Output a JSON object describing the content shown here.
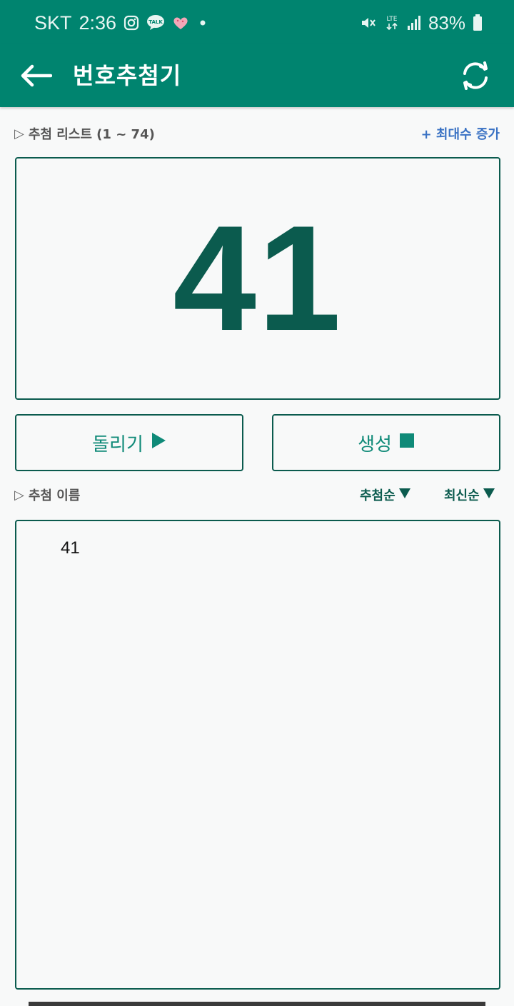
{
  "statusbar": {
    "carrier": "SKT",
    "time": "2:36",
    "notification_icons": [
      "instagram-icon",
      "kakaotalk-icon",
      "heart-icon",
      "dot-icon"
    ],
    "talk_badge": "TALK",
    "lte_label": "LTE",
    "battery": "83%"
  },
  "appbar": {
    "title": "번호추첨기"
  },
  "draw_list": {
    "label": "추첨 리스트 (1 ~ 74)",
    "increase_max_label": "+ 최대수 증가",
    "current_number": "41"
  },
  "actions": {
    "spin_label": "돌리기",
    "generate_label": "생성"
  },
  "names_section": {
    "label": "추첨 이름",
    "sort_draw_order": "추첨순",
    "sort_latest": "최신순",
    "items": [
      "41"
    ]
  },
  "colors": {
    "primary": "#00846f",
    "dark_green": "#0b5b4e",
    "button_text": "#0f8a78",
    "link_blue": "#3a72c4"
  }
}
